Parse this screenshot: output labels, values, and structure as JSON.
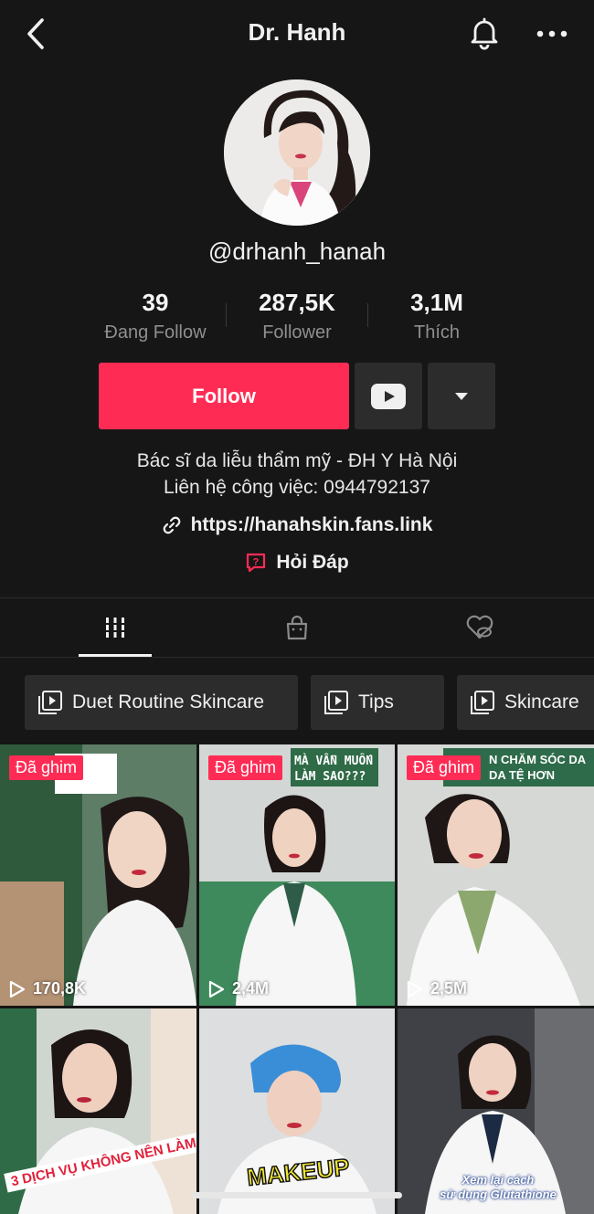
{
  "header": {
    "title": "Dr. Hanh"
  },
  "profile": {
    "username": "@drhanh_hanah",
    "stats": [
      {
        "value": "39",
        "label": "Đang Follow"
      },
      {
        "value": "287,5K",
        "label": "Follower"
      },
      {
        "value": "3,1M",
        "label": "Thích"
      }
    ],
    "follow_label": "Follow",
    "bio_line1": "Bác sĩ da liễu thẩm mỹ - ĐH Y Hà Nội",
    "bio_line2": "Liên hệ công việc: 0944792137",
    "link": "https://hanahskin.fans.link",
    "qa_label": "Hỏi Đáp"
  },
  "playlists": [
    {
      "label": "Duet Routine Skincare"
    },
    {
      "label": "Tips"
    },
    {
      "label": "Skincare"
    }
  ],
  "videos": [
    {
      "pinned": "Đã ghim",
      "views": "170,8K",
      "overlay": "",
      "bg": "#6b8a72"
    },
    {
      "pinned": "Đã ghim",
      "views": "2,4M",
      "overlay": "MÀ VẪN MUỐN\nLÀM SAO???",
      "bg": "#bfc6c2"
    },
    {
      "pinned": "Đã ghim",
      "views": "2,5M",
      "overlay": "N CHĂM SÓC DA\nDA TỆ HƠN",
      "bg": "#cfd2cf"
    },
    {
      "pinned": "",
      "views": "",
      "overlay": "3 DỊCH VỤ KHÔNG NÊN LÀM",
      "bg": "#c9d2cc"
    },
    {
      "pinned": "",
      "views": "",
      "overlay": "MAKEUP",
      "bg": "#d8dadb"
    },
    {
      "pinned": "",
      "views": "",
      "overlay": "Xem lại cách\nsử dụng Glutathione",
      "bg": "#46484c"
    }
  ],
  "colors": {
    "accent": "#fe2c55",
    "bg": "#161616",
    "button_dark": "#2c2c2c"
  }
}
